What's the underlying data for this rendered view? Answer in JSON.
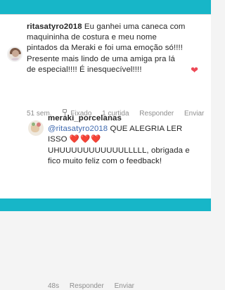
{
  "comments": [
    {
      "username": "ritasatyro2018",
      "text": "Eu ganhei uma caneca com maquininha de costura e meu nome pintados da Meraki e foi uma emoção só!!!! Presente mais lindo de uma amiga pra lá de especial!!!! É inesquecível!!!!",
      "age": "51 sem.",
      "pinned_label": "Fixado",
      "likes_label": "1 curtida",
      "reply_label": "Responder",
      "send_label": "Enviar",
      "liked": true,
      "heart_color": "#ed4956"
    },
    {
      "username": "meraki_porcelanas",
      "mention": "@ritasatyro2018",
      "text_part1": " QUE ALEGRIA LER ISSO ",
      "hearts": "❤️❤️❤️",
      "text_part2": " UHUUUUUUUUUUULLLLL, obrigada e fico muito feliz com o feedback!",
      "age": "48s",
      "reply_label": "Responder",
      "send_label": "Enviar"
    }
  ],
  "colors": {
    "frame": "#17b6c8",
    "mention": "#3f6ab0",
    "meta": "#8e8e8e"
  }
}
